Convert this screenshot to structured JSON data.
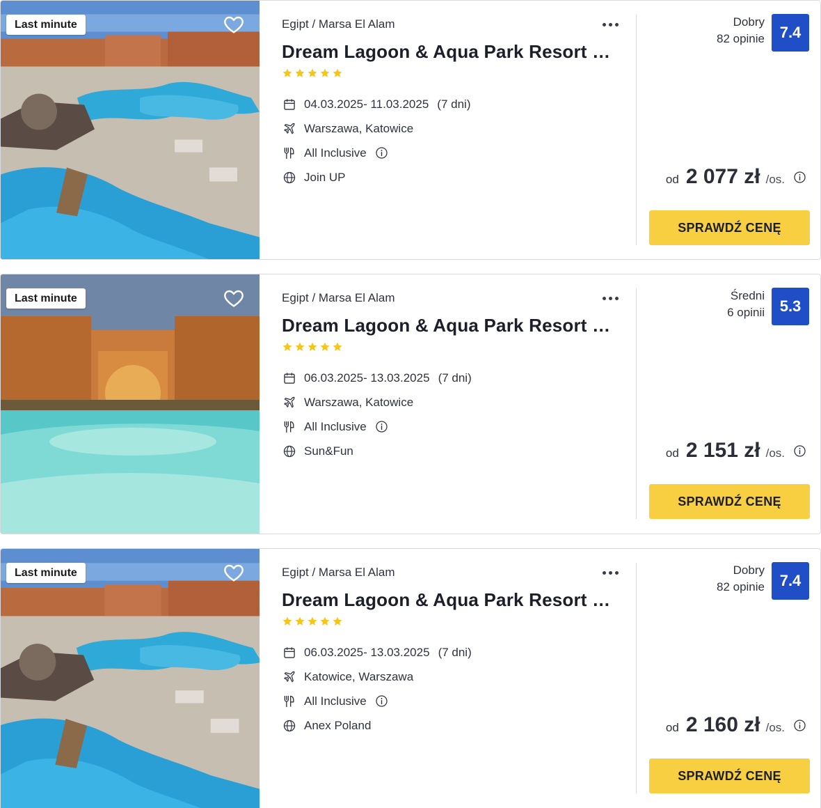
{
  "offers": [
    {
      "badge": "Last minute",
      "location": "Egipt / Marsa El Alam",
      "name": "Dream Lagoon & Aqua Park Resort (ex. Dream Lagoon Resort)",
      "stars": 5,
      "dates": "04.03.2025- 11.03.2025",
      "duration": "(7 dni)",
      "departure": "Warszawa, Katowice",
      "board": "All Inclusive",
      "operator": "Join UP",
      "rating_label": "Dobry",
      "rating_count": "82 opinie",
      "score": "7.4",
      "price_prefix": "od",
      "price": "2 077 zł",
      "price_suffix": "/os.",
      "cta": "SPRAWDŹ CENĘ",
      "photo": "resort-pool-day"
    },
    {
      "badge": "Last minute",
      "location": "Egipt / Marsa El Alam",
      "name": "Dream Lagoon & Aqua Park Resort (ex. Dream Lagoon Resort)",
      "stars": 5,
      "dates": "06.03.2025- 13.03.2025",
      "duration": "(7 dni)",
      "departure": "Warszawa, Katowice",
      "board": "All Inclusive",
      "operator": "Sun&Fun",
      "rating_label": "Średni",
      "rating_count": "6 opinii",
      "score": "5.3",
      "price_prefix": "od",
      "price": "2 151 zł",
      "price_suffix": "/os.",
      "cta": "SPRAWDŹ CENĘ",
      "photo": "resort-pool-night"
    },
    {
      "badge": "Last minute",
      "location": "Egipt / Marsa El Alam",
      "name": "Dream Lagoon & Aqua Park Resort (ex. Dream Lagoon Resort)",
      "stars": 5,
      "dates": "06.03.2025- 13.03.2025",
      "duration": "(7 dni)",
      "departure": "Katowice, Warszawa",
      "board": "All Inclusive",
      "operator": "Anex Poland",
      "rating_label": "Dobry",
      "rating_count": "82 opinie",
      "score": "7.4",
      "price_prefix": "od",
      "price": "2 160 zł",
      "price_suffix": "/os.",
      "cta": "SPRAWDŹ CENĘ",
      "photo": "resort-pool-day"
    }
  ],
  "colors": {
    "cta": "#f7cf40",
    "score": "#1f4ec7",
    "stars": "#f5c518"
  }
}
